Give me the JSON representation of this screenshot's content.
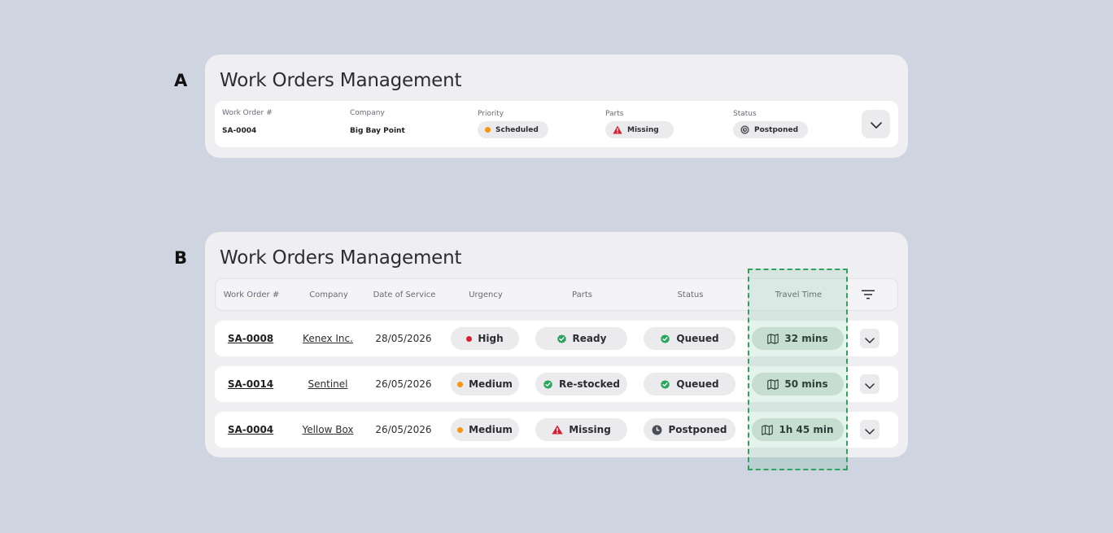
{
  "sections": {
    "a_label": "A",
    "b_label": "B"
  },
  "card_a": {
    "title": "Work Orders Management",
    "fields": {
      "work_order": {
        "label": "Work Order #",
        "value": "SA-0004"
      },
      "company": {
        "label": "Company",
        "value": "Big Bay Point"
      },
      "priority": {
        "label": "Priority",
        "value": "Scheduled",
        "icon": "orange-dot"
      },
      "parts": {
        "label": "Parts",
        "value": "Missing",
        "icon": "warning-triangle-icon"
      },
      "status": {
        "label": "Status",
        "value": "Postponed",
        "icon": "clock-icon"
      }
    },
    "expand_icon": "chevron-down-icon"
  },
  "card_b": {
    "title": "Work Orders Management",
    "columns": {
      "work_order": "Work Order #",
      "company": "Company",
      "date": "Date of Service",
      "urgency": "Urgency",
      "parts": "Parts",
      "status": "Status",
      "travel": "Travel Time"
    },
    "filter_icon": "filter-icon",
    "rows": [
      {
        "work_order": "SA-0008",
        "company": "Kenex Inc.",
        "date": "28/05/2026",
        "urgency": "High",
        "urgency_color": "#d71f34",
        "parts": "Ready",
        "parts_icon": "check-badge-icon",
        "status": "Queued",
        "status_icon": "check-badge-icon",
        "travel": "32 mins"
      },
      {
        "work_order": "SA-0014",
        "company": "Sentinel",
        "date": "26/05/2026",
        "urgency": "Medium",
        "urgency_color": "#f5940f",
        "parts": "Re-stocked",
        "parts_icon": "check-badge-icon",
        "status": "Queued",
        "status_icon": "check-badge-icon",
        "travel": "50 mins"
      },
      {
        "work_order": "SA-0004",
        "company": "Yellow Box",
        "date": "26/05/2026",
        "urgency": "Medium",
        "urgency_color": "#f5940f",
        "parts": "Missing",
        "parts_icon": "warning-triangle-icon",
        "status": "Postponed",
        "status_icon": "clock-icon",
        "travel": "1h 45 min"
      }
    ]
  },
  "colors": {
    "background": "#cfd5e0",
    "card": "#efeff2",
    "success": "#2ea35f",
    "danger": "#d71f34",
    "warning": "#f5940f",
    "highlight_border": "#2ea35f"
  }
}
